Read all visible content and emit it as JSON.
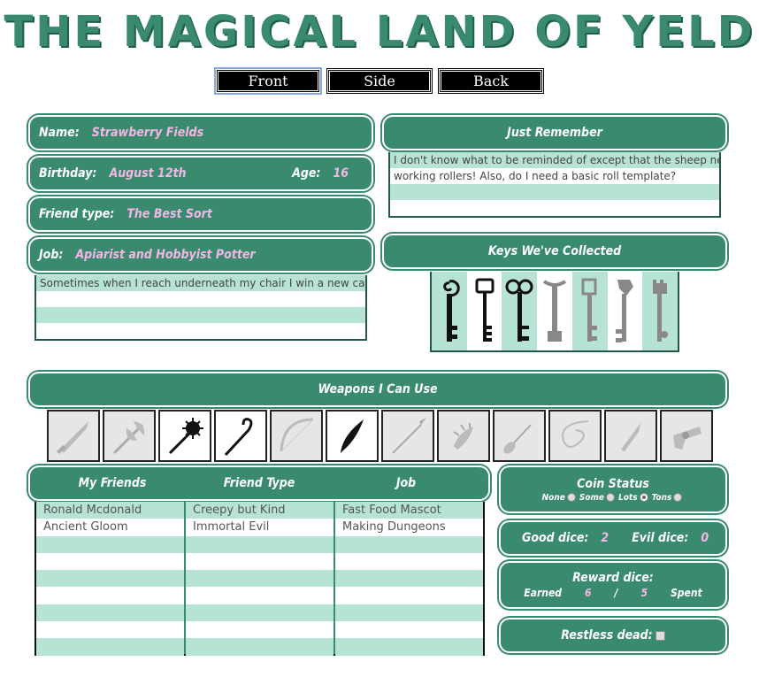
{
  "title": "THE MAGICAL LAND OF YELD",
  "tabs": [
    {
      "label": "Front",
      "active": true
    },
    {
      "label": "Side",
      "active": false
    },
    {
      "label": "Back",
      "active": false
    }
  ],
  "character": {
    "name_label": "Name:",
    "name": "Strawberry Fields",
    "birthday_label": "Birthday:",
    "birthday": "August 12th",
    "age_label": "Age:",
    "age": "16",
    "friend_type_label": "Friend type:",
    "friend_type": "The Best Sort",
    "job_label": "Job:",
    "job": "Apiarist and Hobbyist Potter",
    "job_notes": [
      "Sometimes when I reach underneath my chair I win a new car.",
      "",
      "",
      ""
    ]
  },
  "remember": {
    "title": "Just Remember",
    "lines": [
      "I don't know what to be reminded of except that the sheep need",
      "working rollers! Also, do I need a basic roll template?",
      "",
      ""
    ]
  },
  "keys": {
    "title": "Keys We've Collected",
    "items": [
      {
        "name": "spiral-key",
        "color": "#111111"
      },
      {
        "name": "crown-key",
        "color": "#111111"
      },
      {
        "name": "loop-key",
        "color": "#111111"
      },
      {
        "name": "anchor-key",
        "color": "#888888"
      },
      {
        "name": "square-key",
        "color": "#888888"
      },
      {
        "name": "ornate-key",
        "color": "#888888"
      },
      {
        "name": "tower-key",
        "color": "#888888"
      }
    ]
  },
  "weapons": {
    "title": "Weapons I Can Use",
    "items": [
      {
        "name": "dagger",
        "owned": false
      },
      {
        "name": "battle-axe",
        "owned": false
      },
      {
        "name": "spiked-mace",
        "owned": true
      },
      {
        "name": "shepherds-crook",
        "owned": true
      },
      {
        "name": "bow",
        "owned": false
      },
      {
        "name": "curved-blade",
        "owned": true
      },
      {
        "name": "spear",
        "owned": false
      },
      {
        "name": "spiked-knuckles",
        "owned": false
      },
      {
        "name": "trident",
        "owned": false
      },
      {
        "name": "whip",
        "owned": false
      },
      {
        "name": "knife",
        "owned": false
      },
      {
        "name": "pistol",
        "owned": false
      }
    ]
  },
  "friends": {
    "headers": [
      "My Friends",
      "Friend Type",
      "Job"
    ],
    "rows": [
      [
        "Ronald Mcdonald",
        "Creepy but Kind",
        "Fast Food Mascot"
      ],
      [
        "Ancient Gloom",
        "Immortal Evil",
        "Making Dungeons"
      ],
      [
        "",
        "",
        ""
      ],
      [
        "",
        "",
        ""
      ],
      [
        "",
        "",
        ""
      ],
      [
        "",
        "",
        ""
      ],
      [
        "",
        "",
        ""
      ],
      [
        "",
        "",
        ""
      ],
      [
        "",
        "",
        ""
      ]
    ]
  },
  "coin": {
    "title": "Coin Status",
    "options": [
      {
        "label": "None",
        "checked": false
      },
      {
        "label": "Some",
        "checked": false
      },
      {
        "label": "Lots",
        "checked": true
      },
      {
        "label": "Tons",
        "checked": false
      }
    ]
  },
  "dice": {
    "good_label": "Good dice:",
    "good": "2",
    "evil_label": "Evil dice:",
    "evil": "0"
  },
  "reward": {
    "title": "Reward dice:",
    "earned_label": "Earned",
    "earned": "6",
    "separator": "/",
    "spent": "5",
    "spent_label": "Spent"
  },
  "restless": {
    "label": "Restless dead:",
    "checked": false
  },
  "colors": {
    "accent": "#3a8a6e",
    "stripe": "#b7e3d3",
    "value": "#f4b6e6"
  }
}
